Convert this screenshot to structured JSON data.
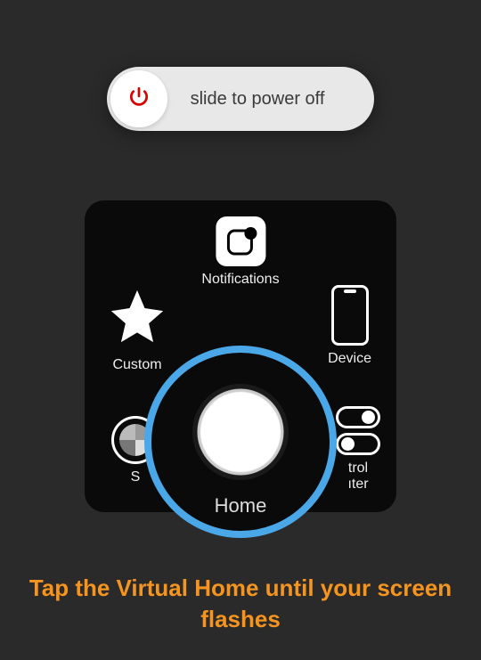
{
  "power_slider": {
    "label": "slide to power off"
  },
  "assistive_touch": {
    "notifications_label": "Notifications",
    "custom_label": "Custom",
    "device_label": "Device",
    "siri_label_visible": "S",
    "control_label_line1_visible": "trol",
    "control_label_line2_visible": "ıter",
    "home_label": "Home"
  },
  "instruction_text": "Tap the Virtual Home until your screen flashes",
  "colors": {
    "highlight_ring": "#4aa8e8",
    "instruction": "#f5941f"
  }
}
